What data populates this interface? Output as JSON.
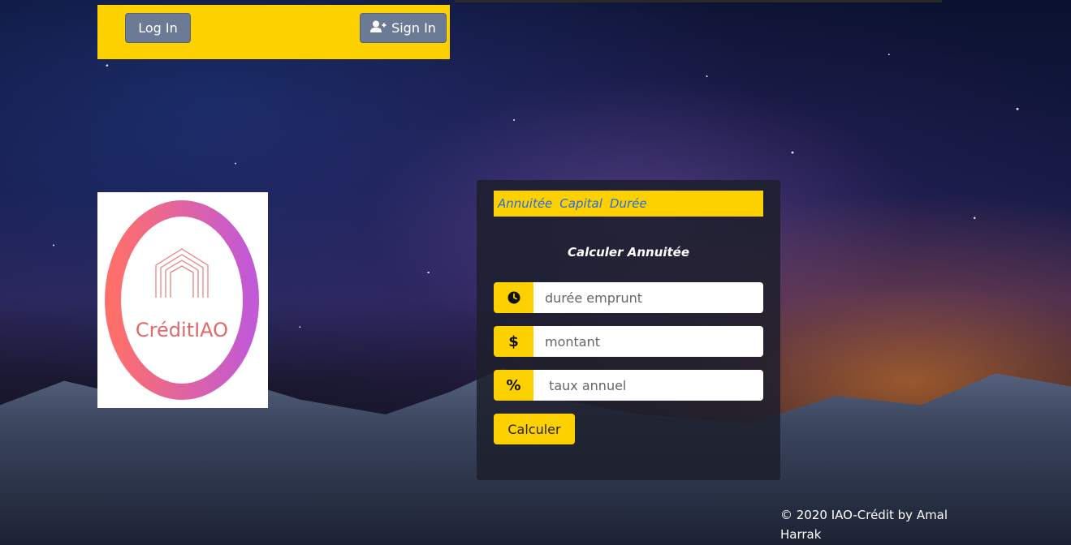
{
  "nav": {
    "login_label": "Log In",
    "signin_label": "Sign In"
  },
  "logo": {
    "text": "CréditIAO"
  },
  "tabs": [
    {
      "label": "Annuitée"
    },
    {
      "label": "Capital"
    },
    {
      "label": "Durée"
    }
  ],
  "form": {
    "title": "Calculer Annuitée",
    "duration_placeholder": "durée emprunt",
    "amount_placeholder": "montant",
    "rate_placeholder": " taux annuel",
    "amount_symbol": "$",
    "rate_symbol": "%",
    "submit_label": "Calculer"
  },
  "footer": {
    "text": "© 2020 IAO-Crédit by Amal Harrak"
  },
  "colors": {
    "accent": "#fdd000",
    "nav_button": "#6c7b95",
    "tab_text": "#2a6be0"
  },
  "icons": {
    "clock": "clock-icon",
    "user_plus": "user-plus-icon"
  }
}
